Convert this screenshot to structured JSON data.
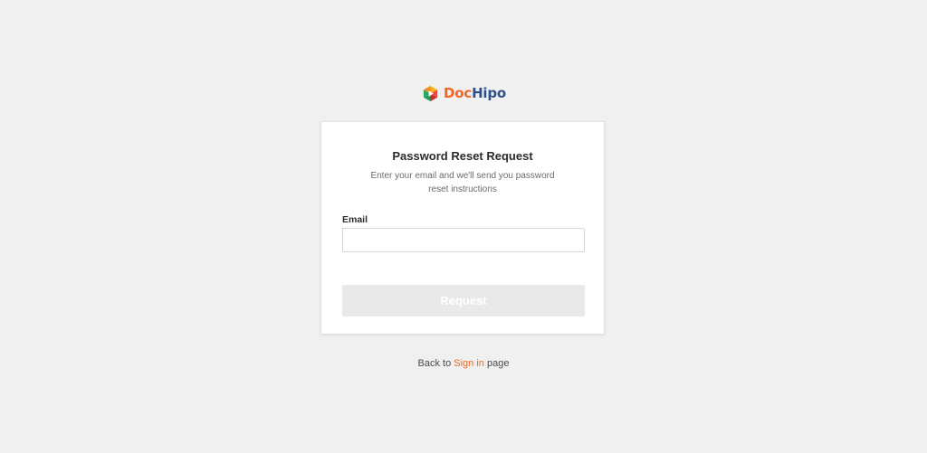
{
  "brand": {
    "name_part1": "Doc",
    "name_part2": "Hipo",
    "color_primary": "#f26522",
    "color_secondary": "#2d4f8a"
  },
  "card": {
    "title": "Password Reset Request",
    "subtitle": "Enter your email and we'll send you password reset instructions",
    "email_label": "Email",
    "email_value": "",
    "email_placeholder": "",
    "request_label": "Request"
  },
  "footer": {
    "back_prefix": "Back to",
    "sign_in_link": "Sign in",
    "back_suffix": "page"
  }
}
